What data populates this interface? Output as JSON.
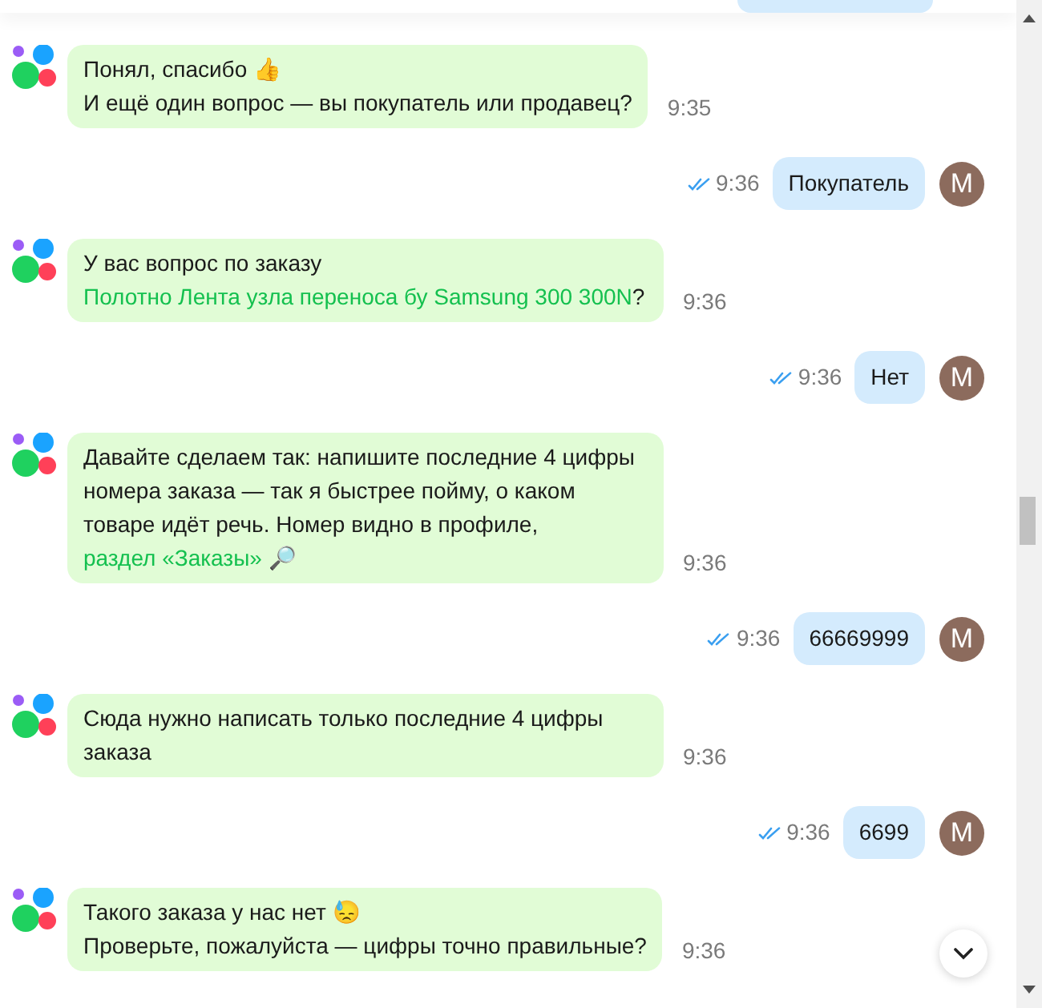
{
  "messages": [
    {
      "kind": "in",
      "parts": [
        {
          "kind": "text",
          "text": "Понял, спасибо 👍\nИ ещё один вопрос — вы покупатель или продавец?"
        }
      ],
      "time": "9:35"
    },
    {
      "kind": "out",
      "parts": [
        {
          "kind": "text",
          "text": "Покупатель"
        }
      ],
      "time": "9:36",
      "read": true,
      "avatar": "M"
    },
    {
      "kind": "in",
      "parts": [
        {
          "kind": "text",
          "text": "У вас вопрос по заказу "
        },
        {
          "kind": "link",
          "text": "Полотно Лента узла переноса бу Samsung 300 300N"
        },
        {
          "kind": "text",
          "text": "?"
        }
      ],
      "time": "9:36"
    },
    {
      "kind": "out",
      "parts": [
        {
          "kind": "text",
          "text": "Нет"
        }
      ],
      "time": "9:36",
      "read": true,
      "avatar": "M"
    },
    {
      "kind": "in",
      "parts": [
        {
          "kind": "text",
          "text": "Давайте сделаем так: напишите последние 4 цифры номера заказа — так я быстрее пойму, о каком товаре идёт речь. Номер видно в профиле, "
        },
        {
          "kind": "link",
          "text": "раздел «Заказы»"
        },
        {
          "kind": "text",
          "text": " 🔎"
        }
      ],
      "time": "9:36"
    },
    {
      "kind": "out",
      "parts": [
        {
          "kind": "text",
          "text": "66669999"
        }
      ],
      "time": "9:36",
      "read": true,
      "avatar": "M"
    },
    {
      "kind": "in",
      "parts": [
        {
          "kind": "text",
          "text": "Сюда нужно написать только последние 4 цифры заказа"
        }
      ],
      "time": "9:36"
    },
    {
      "kind": "out",
      "parts": [
        {
          "kind": "text",
          "text": "6699"
        }
      ],
      "time": "9:36",
      "read": true,
      "avatar": "M"
    },
    {
      "kind": "in",
      "parts": [
        {
          "kind": "text",
          "text": "Такого заказа у нас нет 😓\nПроверьте, пожалуйста — цифры точно правильные?"
        }
      ],
      "time": "9:36"
    }
  ]
}
